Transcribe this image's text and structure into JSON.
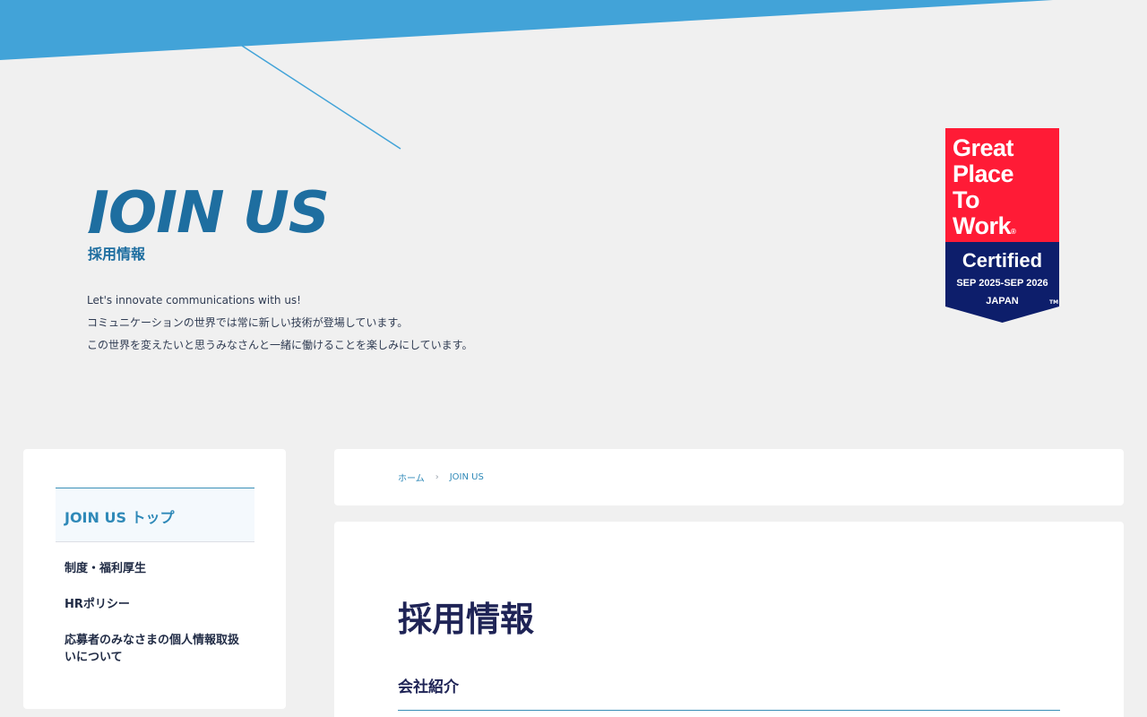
{
  "hero": {
    "title": "JOIN US",
    "subtitle": "採用情報",
    "lines": [
      "Let's innovate communications with us!",
      "コミュニケーションの世界では常に新しい技術が登場しています。",
      "この世界を変えたいと思うみなさんと一緒に働けることを楽しみにしています。"
    ]
  },
  "badge": {
    "line1": "Great",
    "line2": "Place",
    "line3": "To",
    "line4": "Work",
    "reg": "®",
    "certified": "Certified",
    "dates": "SEP 2025-SEP 2026",
    "country": "JAPAN",
    "tm": "TM",
    "colors": {
      "red": "#ff1b36",
      "navy": "#0d1e6b"
    }
  },
  "sidebar": {
    "active": "JOIN US トップ",
    "items": [
      {
        "label": "制度・福利厚生"
      },
      {
        "label": "HRポリシー"
      },
      {
        "label": "応募者のみなさまの個人情報取扱いについて"
      }
    ]
  },
  "breadcrumb": {
    "home": "ホーム",
    "sep": "›",
    "current": "JOIN US"
  },
  "main": {
    "title": "採用情報",
    "section": "会社紹介"
  },
  "colors": {
    "accent": "#42a3d8",
    "heading": "#1e6ea0",
    "dark": "#1f2456"
  }
}
